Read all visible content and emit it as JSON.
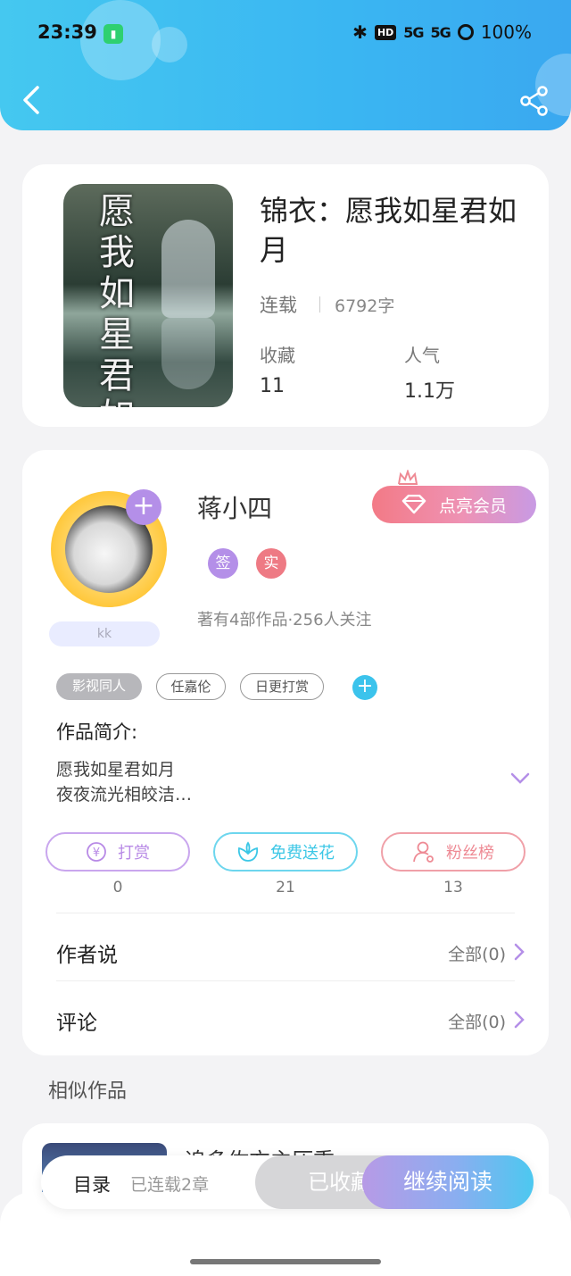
{
  "status_bar": {
    "time": "23:39",
    "hd_label": "HD",
    "signal1": "5G",
    "signal2": "5G",
    "battery": "100%"
  },
  "book": {
    "title": "锦衣：愿我如星君如月",
    "status": "连载",
    "words": "6792字",
    "stats": [
      {
        "label": "收藏",
        "value": "11"
      },
      {
        "label": "人气",
        "value": "1.1万"
      }
    ],
    "cover_text": "愿我如星君如月"
  },
  "author": {
    "name": "蒋小四",
    "tag_name": "kk",
    "vip_label": "点亮会员",
    "badges": [
      "签",
      "实"
    ],
    "meta": "著有4部作品·256人关注",
    "tags": [
      "影视同人",
      "任嘉伦",
      "日更打赏"
    ],
    "intro_title": "作品简介:",
    "intro_lines": [
      "愿我如星君如月",
      "夜夜流光相皎洁…"
    ],
    "actions": [
      {
        "label": "打赏",
        "count": "0",
        "color": "#b88ae6"
      },
      {
        "label": "免费送花",
        "count": "21",
        "color": "#3cc7e6"
      },
      {
        "label": "粉丝榜",
        "count": "13",
        "color": "#ee8a94"
      }
    ],
    "rows": [
      {
        "label": "作者说",
        "right": "全部(0)"
      },
      {
        "label": "评论",
        "right": "全部(0)"
      }
    ]
  },
  "similar": {
    "title": "相似作品",
    "first_name": "追多佐方主压重"
  },
  "bottom_bar": {
    "toc": "目录",
    "chapters": "已连载2章",
    "favorited": "已收藏",
    "continue": "继续阅读"
  },
  "colors": {
    "header": "#3ab6f2",
    "accent_purple": "#b48fe8",
    "accent_blue": "#3bc3ec"
  }
}
